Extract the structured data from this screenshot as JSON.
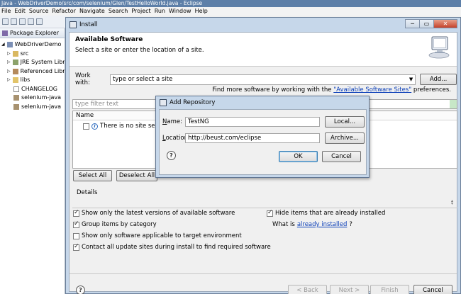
{
  "eclipse": {
    "title": "Java - WebDriverDemo/src/com/selenium/Glen/TestHelloWorld.java - Eclipse",
    "menus": [
      "File",
      "Edit",
      "Source",
      "Refactor",
      "Navigate",
      "Search",
      "Project",
      "Run",
      "Window",
      "Help"
    ],
    "package_explorer": {
      "title": "Package Explorer",
      "items": [
        {
          "label": "WebDriverDemo",
          "icon": "project-icon"
        },
        {
          "label": "src",
          "icon": "package-folder-icon"
        },
        {
          "label": "JRE System Library",
          "icon": "library-icon"
        },
        {
          "label": "Referenced Libraries",
          "icon": "library-icon"
        },
        {
          "label": "libs",
          "icon": "folder-icon"
        },
        {
          "label": "CHANGELOG",
          "icon": "file-icon"
        },
        {
          "label": "selenium-java",
          "icon": "jar-icon"
        },
        {
          "label": "selenium-java",
          "icon": "jar-icon"
        }
      ]
    }
  },
  "install": {
    "title": "Install",
    "header_title": "Available Software",
    "header_subtitle": "Select a site or enter the location of a site.",
    "work_with_label": "Work with:",
    "work_with_value": "type or select a site",
    "add_button": "Add...",
    "find_more_prefix": "Find more software by working with the ",
    "find_more_link": "\"Available Software Sites\"",
    "find_more_suffix": " preferences.",
    "filter_placeholder": "type filter text",
    "table_header_name": "Name",
    "table_row": "There is no site selected.",
    "select_all": "Select All",
    "deselect_all": "Deselect All",
    "details_label": "Details",
    "options": {
      "latest_versions": "Show only the latest versions of available software",
      "group_by_category": "Group items by category",
      "applicable_only": "Show only software applicable to target environment",
      "contact_update_sites": "Contact all update sites during install to find required software",
      "hide_installed": "Hide items that are already installed",
      "what_is_prefix": "What is ",
      "what_is_link": "already installed",
      "what_is_suffix": "?"
    },
    "buttons": {
      "back": "< Back",
      "next": "Next >",
      "finish": "Finish",
      "cancel": "Cancel"
    }
  },
  "add_repository": {
    "title": "Add Repository",
    "name_label_u": "N",
    "name_label_rest": "ame:",
    "name_value": "TestNG",
    "location_label_u": "L",
    "location_label_rest": "ocation:",
    "location_value": "http://beust.com/eclipse",
    "local_button": "Local...",
    "archive_button": "Archive...",
    "ok_button": "OK",
    "cancel_button": "Cancel"
  },
  "colors": {
    "dialog_frame": "#c6d7ea",
    "link": "#0b3fb8",
    "title_bar": "#5d7fa8"
  }
}
